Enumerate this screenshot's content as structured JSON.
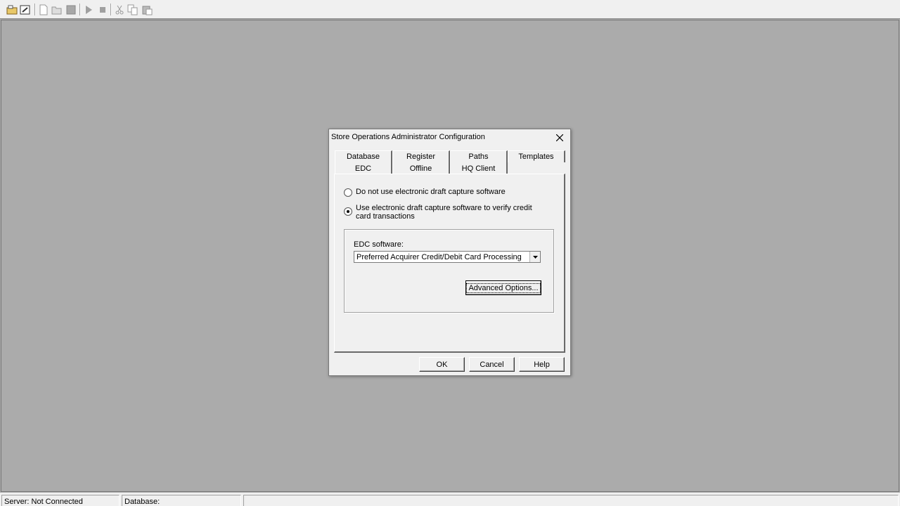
{
  "dialog": {
    "title": "Store Operations Administrator Configuration",
    "tabs_row1": [
      "Database",
      "Register",
      "Paths",
      "Templates"
    ],
    "tabs_row2": [
      "EDC",
      "Offline",
      "HQ Client"
    ],
    "active_tab": "EDC",
    "radio_no_edc": {
      "label": "Do not use electronic draft capture software",
      "checked": false
    },
    "radio_use_edc": {
      "label_line1": "Use electronic draft capture software to verify credit",
      "label_line2": "card transactions",
      "checked": true
    },
    "edc_software_label": "EDC software:",
    "edc_software_value": "Preferred Acquirer Credit/Debit Card Processing",
    "advanced_options_label": "Advanced Options...",
    "buttons": {
      "ok": "OK",
      "cancel": "Cancel",
      "help": "Help"
    }
  },
  "statusbar": {
    "server": "Server: Not Connected",
    "database": "Database:"
  },
  "colors": {
    "desktop": "#ababab",
    "chrome": "#f0f0f0"
  }
}
